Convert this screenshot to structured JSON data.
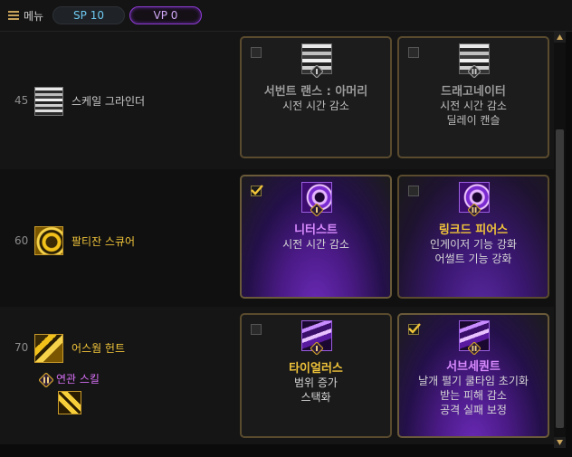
{
  "topbar": {
    "menu_label": "메뉴",
    "sp_label": "SP 10",
    "vp_label": "VP 0"
  },
  "rows": [
    {
      "level": "45",
      "skill_name": "스케일 그라인더",
      "skill_name_color": "#c9c9c9",
      "options": [
        {
          "checked": false,
          "badge": "I",
          "title": "서번트 랜스 : 아머리",
          "lines": [
            "시전 시간 감소"
          ],
          "style": "grey"
        },
        {
          "checked": false,
          "badge": "II",
          "title": "드래고네이터",
          "lines": [
            "시전 시간 감소",
            "딜레이 캔슬"
          ],
          "style": "grey"
        }
      ]
    },
    {
      "level": "60",
      "skill_name": "팔티잔 스큐어",
      "skill_name_color": "#f0c43a",
      "options": [
        {
          "checked": true,
          "badge": "I",
          "title": "니터스트",
          "lines": [
            "시전 시간 감소"
          ],
          "style": "violet"
        },
        {
          "checked": false,
          "badge": "II",
          "title": "링크드 피어스",
          "lines": [
            "인게이저 기능 강화",
            "어썰트 기능 강화"
          ],
          "style": "gold"
        }
      ]
    },
    {
      "level": "70",
      "skill_name": "어스웜 헌트",
      "skill_name_color": "#f0c43a",
      "associated_label": "연관 스킬",
      "options": [
        {
          "checked": false,
          "badge": "I",
          "title": "타이얼러스",
          "lines": [
            "범위 증가",
            "스택화"
          ],
          "style": "gold"
        },
        {
          "checked": true,
          "badge": "II",
          "title": "서브세퀀트",
          "lines": [
            "날개 펼기 쿨타임 초기화",
            "받는 피해 감소",
            "공격 실패 보정"
          ],
          "style": "violet"
        }
      ]
    }
  ],
  "colors": {
    "gold": "#f0c43a",
    "violet": "#d98bff",
    "sp": "#6ec9f0",
    "vp_border": "#8c3bd2"
  }
}
